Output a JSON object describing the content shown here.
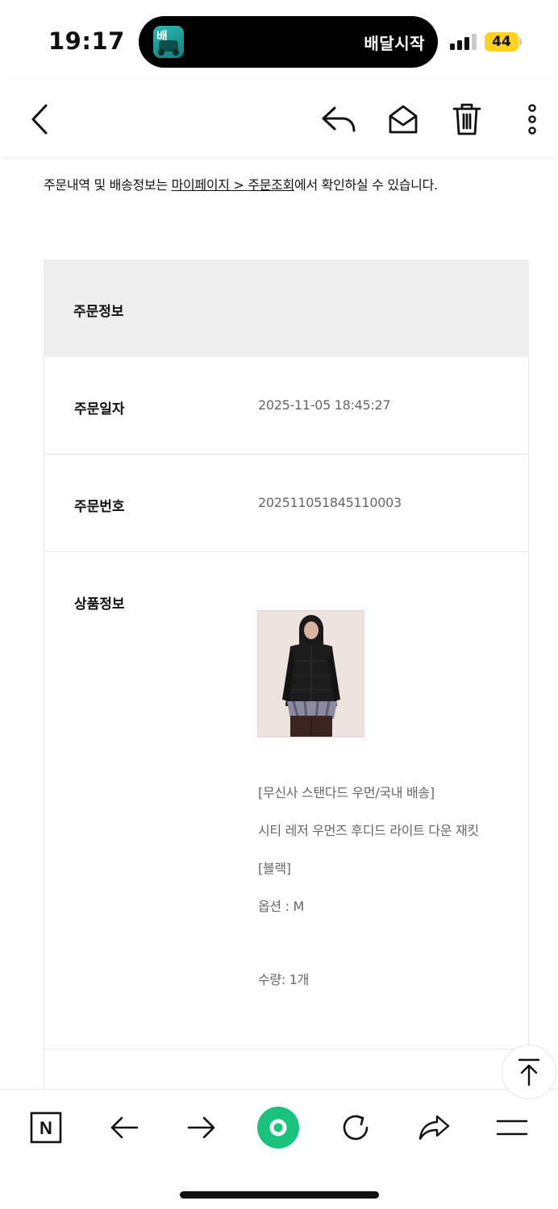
{
  "status_bar": {
    "time": "19:17",
    "live_activity": {
      "app_glyph": "배",
      "text": "배달시작"
    },
    "battery_level": "44",
    "signal_bars_active": 3,
    "signal_bars_total": 4
  },
  "toolbar": {
    "icons": [
      "back-chevron-icon",
      "reply-icon",
      "mail-open-icon",
      "trash-icon",
      "more-vertical-icon"
    ]
  },
  "notice": {
    "prefix": "주문내역 및 배송정보는 ",
    "link": "마이페이지 > 주문조회",
    "suffix": "에서 확인하실 수 있습니다."
  },
  "order": {
    "header_label": "주문정보",
    "date_label": "주문일자",
    "date_value": "2025-11-05 18:45:27",
    "number_label": "주문번호",
    "number_value": "202511051845110003",
    "product_label": "상품정보",
    "product_lines": {
      "brand": "[무신사 스탠다드 우먼/국내 배송]",
      "name": "시티 레저 우먼즈 후디드 라이트 다운 재킷",
      "color": "[블랙]",
      "option": "옵션 : M",
      "quantity": "수량: 1개"
    }
  },
  "colors": {
    "accent_green": "#19c37d",
    "header_bg": "#eeeeee",
    "battery": "#ffd21f"
  },
  "bottom_bar": {
    "icons": [
      "naver-n-icon",
      "back-arrow-icon",
      "forward-arrow-icon",
      "green-dot-icon",
      "refresh-icon",
      "share-icon",
      "menu-icon"
    ],
    "naver_letter": "N"
  }
}
